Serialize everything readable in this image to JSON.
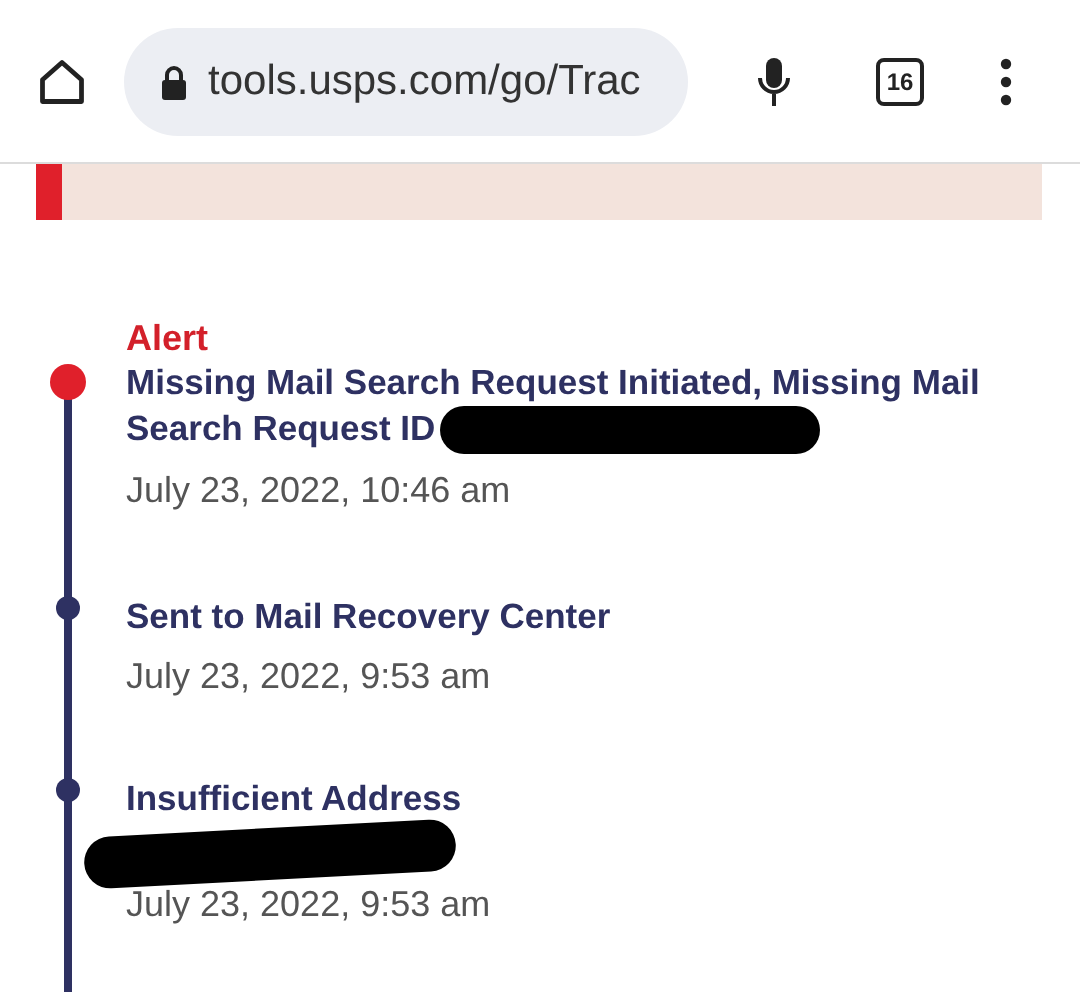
{
  "browser": {
    "url": "tools.usps.com/go/Trac",
    "tab_count": "16"
  },
  "events": [
    {
      "kind": "alert",
      "label": "Alert",
      "title": "Missing Mail Search Request Initiated, Missing Mail Search Request ID",
      "id_redacted": true,
      "date": "July 23, 2022, 10:46 am"
    },
    {
      "kind": "normal",
      "title": "Sent to Mail Recovery Center",
      "date": "July 23, 2022, 9:53 am"
    },
    {
      "kind": "normal",
      "title": "Insufficient Address",
      "line_redacted": true,
      "date": "July 23, 2022, 9:53 am"
    }
  ]
}
